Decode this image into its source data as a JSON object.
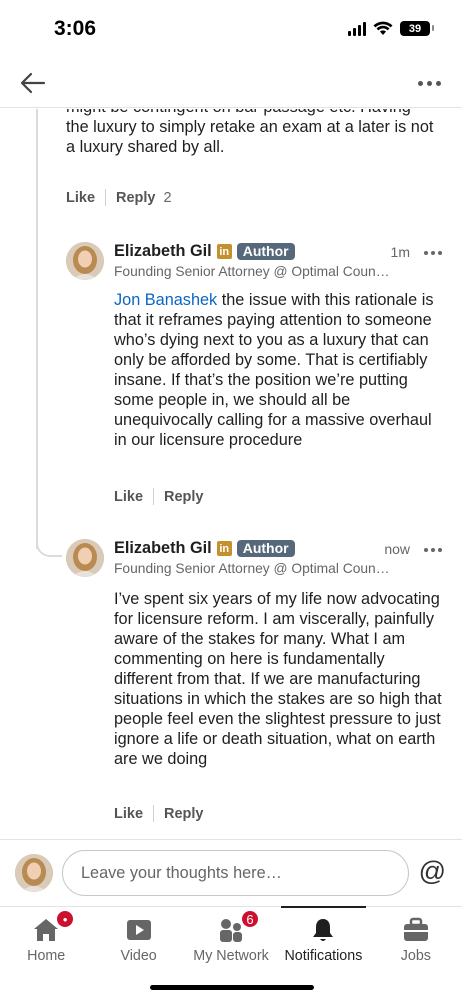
{
  "status_bar": {
    "time": "3:06",
    "battery": "39"
  },
  "top_nav": {
    "back_icon": "arrow-left-icon",
    "more_icon": "more-horizontal-icon"
  },
  "parent_comment": {
    "text": "might be contingent on bar passage etc. Having the luxury to simply retake an exam at a later is not a luxury shared by all.",
    "like_label": "Like",
    "reply_label": "Reply",
    "reply_count": "2"
  },
  "replies": [
    {
      "name": "Elizabeth Gil",
      "in_badge": "in",
      "author_badge": "Author",
      "time": "1m",
      "subtitle": "Founding Senior Attorney @ Optimal Coun…",
      "mention": "Jon Banashek",
      "text": " the issue with this rationale is that it reframes paying attention to someone who’s dying next to you as a luxury that can only be afforded by some. That is certifiably insane. If that’s the position we’re putting some people in, we should all be unequivocally calling for a massive overhaul in our licensure procedure",
      "like_label": "Like",
      "reply_label": "Reply"
    },
    {
      "name": "Elizabeth Gil",
      "in_badge": "in",
      "author_badge": "Author",
      "time": "now",
      "subtitle": "Founding Senior Attorney @ Optimal Coun…",
      "text": "I’ve spent six years of my life now advocating for licensure reform. I am viscerally, painfully aware of the stakes for many. What I am commenting on here is fundamentally different from that. If we are manufacturing situations in which the stakes are so high that people feel even the slightest pressure to just ignore a life or death situation, what on earth are we doing",
      "like_label": "Like",
      "reply_label": "Reply"
    }
  ],
  "input_bar": {
    "placeholder": "Leave your thoughts here…",
    "at_symbol": "@"
  },
  "bottom_nav": {
    "items": [
      {
        "label": "Home",
        "icon": "home-icon"
      },
      {
        "label": "Video",
        "icon": "video-icon"
      },
      {
        "label": "My Network",
        "icon": "network-icon",
        "badge": "6"
      },
      {
        "label": "Notifications",
        "icon": "bell-icon"
      },
      {
        "label": "Jobs",
        "icon": "briefcase-icon"
      }
    ]
  },
  "colors": {
    "link": "#0a66c2",
    "badge_red": "#cb112d",
    "author_badge": "#56687a",
    "linkedin_gold": "#c3912f"
  }
}
